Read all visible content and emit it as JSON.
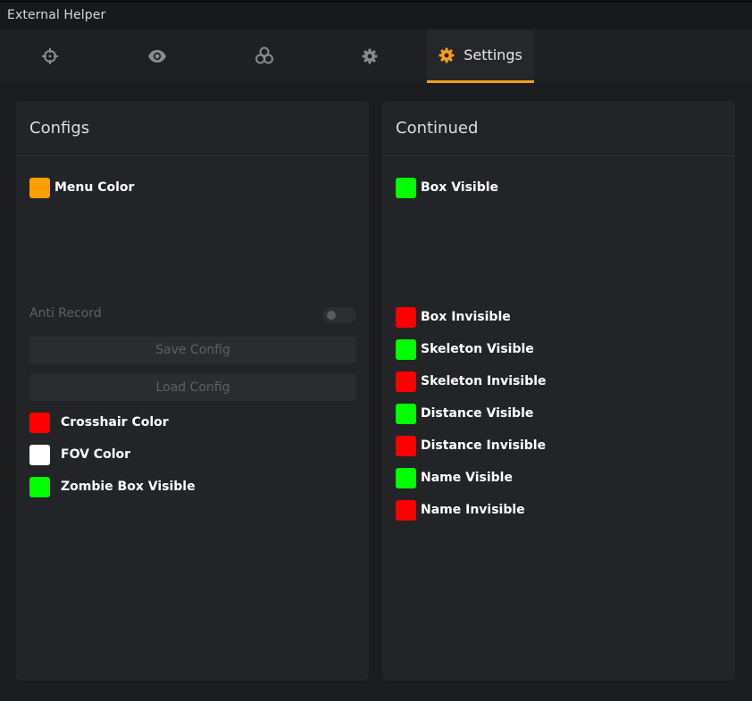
{
  "window": {
    "title": "External Helper"
  },
  "tabs": [
    {
      "icon": "crosshair-icon"
    },
    {
      "icon": "eye-icon"
    },
    {
      "icon": "biohazard-icon"
    },
    {
      "icon": "gear-icon"
    },
    {
      "icon": "gear-icon",
      "label": "Settings",
      "active": true
    }
  ],
  "accent_color": "#f5a01c",
  "configs": {
    "title": "Configs",
    "menu_color": {
      "label": "Menu Color",
      "color": "#ffa000"
    },
    "anti_record": {
      "label": "Anti Record",
      "enabled": false
    },
    "save_config": "Save Config",
    "load_config": "Load Config",
    "colors": [
      {
        "label": "Crosshair Color",
        "color": "#ff0000"
      },
      {
        "label": "FOV Color",
        "color": "#ffffff"
      },
      {
        "label": "Zombie Box Visible",
        "color": "#00ff00"
      }
    ]
  },
  "continued": {
    "title": "Continued",
    "box_visible": {
      "label": "Box Visible",
      "color": "#00ff00"
    },
    "colors": [
      {
        "label": "Box Invisible",
        "color": "#ff0000"
      },
      {
        "label": "Skeleton Visible",
        "color": "#00ff00"
      },
      {
        "label": "Skeleton Invisible",
        "color": "#ff0000"
      },
      {
        "label": "Distance Visible",
        "color": "#00ff00"
      },
      {
        "label": "Distance Invisible",
        "color": "#ff0000"
      },
      {
        "label": "Name Visible",
        "color": "#00ff00"
      },
      {
        "label": "Name Invisible",
        "color": "#ff0000"
      }
    ]
  }
}
